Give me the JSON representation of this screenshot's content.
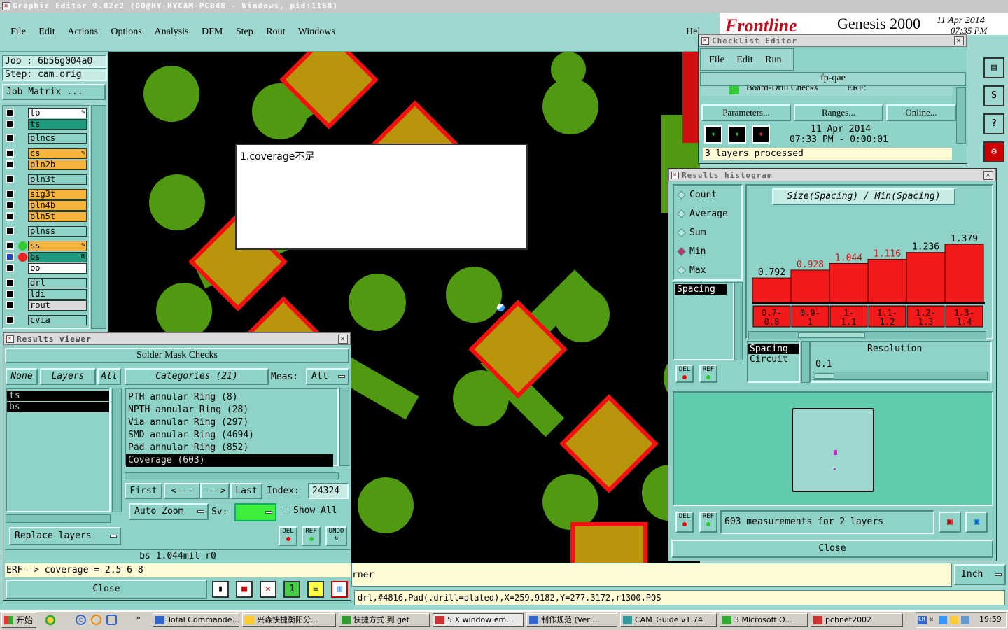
{
  "main_window": {
    "title": "Graphic Editor 9.02c2  (OO@HY-HYCAM-PC048 - Windows, pid:1188)",
    "menu": [
      "File",
      "Edit",
      "Actions",
      "Options",
      "Analysis",
      "DFM",
      "Step",
      "Rout",
      "Windows"
    ],
    "help": "Hel",
    "brand_text": "Frontline",
    "product": "Genesis 2000",
    "date": "11 Apr 2014",
    "time_partial": "07:35 PM"
  },
  "job": {
    "job_label": "Job : 6b56g004a0",
    "step_label": "Step: cam.orig",
    "matrix_button": "Job Matrix ..."
  },
  "layers": [
    {
      "name": "to",
      "color": "#ffffff",
      "mark": "✎"
    },
    {
      "name": "ts",
      "color": "#1e9a7e",
      "mark": ""
    },
    {
      "name": "plncs",
      "color": "#8fd3c8",
      "mark": ""
    },
    {
      "name": "cs",
      "color": "#f5b53d",
      "mark": "✎"
    },
    {
      "name": "pln2b",
      "color": "#f5b53d",
      "mark": ""
    },
    {
      "name": "pln3t",
      "color": "#8fd3c8",
      "mark": ""
    },
    {
      "name": "sig3t",
      "color": "#f5b53d",
      "mark": ""
    },
    {
      "name": "pln4b",
      "color": "#f5b53d",
      "mark": ""
    },
    {
      "name": "pln5t",
      "color": "#f5b53d",
      "mark": ""
    },
    {
      "name": "plnss",
      "color": "#8fd3c8",
      "mark": ""
    },
    {
      "name": "ss",
      "color": "#f5b53d",
      "mark": "✎"
    },
    {
      "name": "bs",
      "color": "#1e9a7e",
      "mark": "⊞"
    },
    {
      "name": "bo",
      "color": "#ffffff",
      "mark": ""
    },
    {
      "name": "drl",
      "color": "#8fd3c8",
      "mark": ""
    },
    {
      "name": "ldi",
      "color": "#8fd3c8",
      "mark": ""
    },
    {
      "name": "rout",
      "color": "#d9d9d9",
      "mark": ""
    },
    {
      "name": "cvia",
      "color": "#8fd3c8",
      "mark": ""
    }
  ],
  "note_popup": {
    "text": "1.coverage不足"
  },
  "results_viewer": {
    "title": "Results viewer",
    "header": "Solder Mask Checks",
    "tabs": [
      "None",
      "Layers",
      "All"
    ],
    "layer_list": [
      "ts",
      "bs"
    ],
    "categories_label": "Categories (21)",
    "meas_label": "Meas:",
    "meas_value": "All",
    "categories": [
      "PTH annular Ring (8)",
      "NPTH annular Ring (28)",
      "Via annular Ring (297)",
      "SMD annular Ring (4694)",
      "Pad annular Ring (852)",
      "Coverage (603)"
    ],
    "selected_category": 5,
    "nav": [
      "First",
      "<---",
      "--->",
      "Last"
    ],
    "index_label": "Index:",
    "index_value": "24324",
    "auto_zoom": "Auto Zoom",
    "sv_label": "Sv:",
    "show_all": "Show All",
    "replace_layers": "Replace layers",
    "del": "DEL",
    "ref": "REF",
    "undo": "UNDO",
    "status_line": "bs 1.044mil  r0",
    "erf_line": "ERF--> coverage = 2.5 6 8",
    "close": "Close"
  },
  "checklist": {
    "title": "Checklist Editor",
    "menu": [
      "File",
      "Edit",
      "Run"
    ],
    "name": "fp-qae",
    "row_text": "Board-Drill Checks",
    "erf": "ERF:",
    "buttons": [
      "Parameters...",
      "Ranges...",
      "Online..."
    ],
    "date": "11 Apr 2014",
    "time": "07:33 PM - 0:00:01",
    "status": "3 layers processed"
  },
  "histogram": {
    "title": "Results histogram",
    "options": [
      "Count",
      "Average",
      "Sum",
      "Min",
      "Max"
    ],
    "selected_option": "Min",
    "measure_list": [
      "Spacing"
    ],
    "chart_title": "Size(Spacing) / Min(Spacing)",
    "legend_items": [
      "Spacing",
      "Circuit"
    ],
    "resolution_label": "Resolution",
    "resolution_value": "0.1",
    "summary": "603 measurements for 2 layers",
    "close": "Close",
    "del": "DEL",
    "ref": "REF"
  },
  "chart_data": {
    "type": "bar",
    "title": "Size(Spacing) / Min(Spacing)",
    "categories": [
      "0.7-0.8",
      "0.9-1",
      "1-1.1",
      "1.1-1.2",
      "1.2-1.3",
      "1.3-1.4"
    ],
    "values": [
      0.792,
      0.928,
      1.044,
      1.116,
      1.236,
      1.379
    ],
    "value_labels": [
      "0.792",
      "0.928",
      "1.044",
      "1.116",
      "1.236",
      "1.379"
    ],
    "highlighted_labels": [
      1,
      2,
      3
    ],
    "bar_color": "#f21a1a",
    "ylim": [
      0,
      1.45
    ]
  },
  "bottom": {
    "status_partial": "rner",
    "units": "Inch",
    "feature_info": "drl,#4816,Pad(.drill=plated),X=259.9182,Y=277.3172,r1300,POS"
  },
  "taskbar": {
    "start": "开始",
    "items": [
      "Total Commande...",
      "兴森快捷衡阳分...",
      "快捷方式 到 get",
      "5 X window em...",
      "制作规范 (Ver:...",
      "CAM_Guide v1.74",
      "3 Microsoft O...",
      "pcbnet2002"
    ],
    "clock": "19:59"
  },
  "colors": {
    "panel": "#8fd3c8",
    "ring": "#4f9a10",
    "pad_fill": "#b8950a",
    "pad_border": "#f21010",
    "canvas": "#000000"
  }
}
